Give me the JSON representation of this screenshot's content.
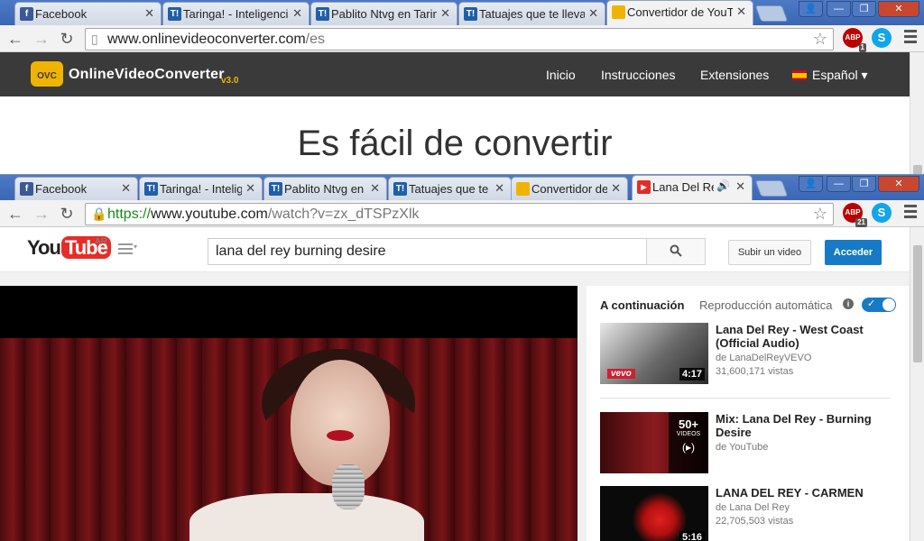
{
  "window1": {
    "tabs": [
      {
        "icon": "f",
        "label": "Facebook"
      },
      {
        "icon": "T!",
        "label": "Taringa! - Inteligencia"
      },
      {
        "icon": "T!",
        "label": "Pablito Ntvg en Taringa"
      },
      {
        "icon": "T!",
        "label": "Tatuajes que te llevan"
      },
      {
        "icon": "",
        "label": "Convertidor de YouTube"
      }
    ],
    "url_host": "www.onlinevideoconverter.com",
    "url_path": "/es",
    "abp_label": "ABP",
    "abp_count": "1",
    "site": {
      "logo_text": "OVC",
      "brand": "OnlineVideoConverter",
      "version": "v3.0",
      "nav": [
        "Inicio",
        "Instrucciones",
        "Extensiones",
        "Español"
      ],
      "hero": "Es fácil de convertir"
    }
  },
  "window2": {
    "tabs": [
      {
        "icon": "f",
        "label": "Facebook"
      },
      {
        "icon": "T!",
        "label": "Taringa! - Inteligencia"
      },
      {
        "icon": "T!",
        "label": "Pablito Ntvg en Taringa"
      },
      {
        "icon": "T!",
        "label": "Tatuajes que te llevan"
      },
      {
        "icon": "",
        "label": "Convertidor de YouTube"
      },
      {
        "icon": "▶",
        "label": "Lana Del Rey"
      }
    ],
    "url_scheme": "https://",
    "url_host": "www.youtube.com",
    "url_path": "/watch?v=zx_dTSPzXlk",
    "abp_label": "ABP",
    "abp_count": "21",
    "youtube": {
      "logo_you": "You",
      "logo_tube": "Tube",
      "region": "AR",
      "search_value": "lana del rey burning desire",
      "upload_label": "Subir un video",
      "login_label": "Acceder",
      "next_label": "A continuación",
      "autoplay_label": "Reproducción automática",
      "autoplay_on": true,
      "videos": [
        {
          "title": "Lana Del Rey - West Coast (Official Audio)",
          "channel": "de LanaDelReyVEVO",
          "views": "31,600,171 vistas",
          "duration": "4:17",
          "badge": "vevo"
        },
        {
          "title": "Mix: Lana Del Rey - Burning Desire",
          "channel": "de YouTube",
          "views": "",
          "mix_count": "50+",
          "mix_label": "VIDEOS"
        },
        {
          "title": "LANA DEL REY - CARMEN",
          "channel": "de Lana Del Rey",
          "views": "22,705,503 vistas",
          "duration": "5:16"
        }
      ]
    }
  },
  "colors": {
    "youtube_red": "#e52d27",
    "youtube_blue": "#167ac6",
    "ovc_yellow": "#f0b400",
    "arrow": "#7a0b14"
  }
}
